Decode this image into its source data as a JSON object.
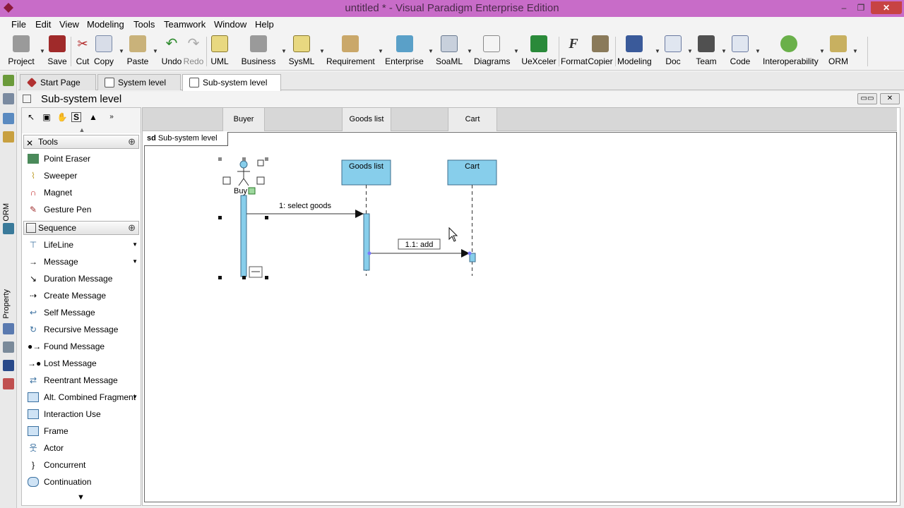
{
  "window": {
    "title": "untitled * - Visual Paradigm Enterprise Edition",
    "minimize": "–",
    "maximize": "❐",
    "close": "✕"
  },
  "menu": [
    "File",
    "Edit",
    "View",
    "Modeling",
    "Tools",
    "Teamwork",
    "Window",
    "Help"
  ],
  "toolbar": {
    "project": "Project",
    "save": "Save",
    "cut": "Cut",
    "copy": "Copy",
    "paste": "Paste",
    "undo": "Undo",
    "redo": "Redo",
    "uml": "UML",
    "business": "Business",
    "sysml": "SysML",
    "requirement": "Requirement",
    "enterprise": "Enterprise",
    "soaml": "SoaML",
    "diagrams": "Diagrams",
    "uexceler": "UeXceler",
    "format": "Format",
    "copier": "Copier",
    "modeling": "Modeling",
    "doc": "Doc",
    "team": "Team",
    "code": "Code",
    "interoperability": "Interoperability",
    "orm": "ORM"
  },
  "side_tabs": {
    "orm": "ORM",
    "property": "Property"
  },
  "tabs": [
    "Start Page",
    "System level",
    "Sub-system level"
  ],
  "diagram": {
    "title": "Sub-system level",
    "frame_keyword": "sd",
    "frame_name": "Sub-system level"
  },
  "palette": {
    "tools_category": "Tools",
    "tools": [
      "Point Eraser",
      "Sweeper",
      "Magnet",
      "Gesture Pen"
    ],
    "sequence_category": "Sequence",
    "sequence": [
      "LifeLine",
      "Message",
      "Duration Message",
      "Create Message",
      "Self Message",
      "Recursive Message",
      "Found Message",
      "Lost Message",
      "Reentrant Message",
      "Alt. Combined Fragment",
      "Interaction Use",
      "Frame",
      "Actor",
      "Concurrent",
      "Continuation"
    ],
    "select_tool": "S"
  },
  "lanes": [
    "Buyer",
    "Goods list",
    "Cart"
  ],
  "sequence": {
    "actor": "Buy",
    "lifelines": [
      "Goods list",
      "Cart"
    ],
    "messages": [
      "1: select goods",
      "1.1: add"
    ]
  },
  "colors": {
    "titlebar": "#c86cc8",
    "lifeline_fill": "#87ceeb",
    "lifeline_border": "#3c6e8c"
  }
}
